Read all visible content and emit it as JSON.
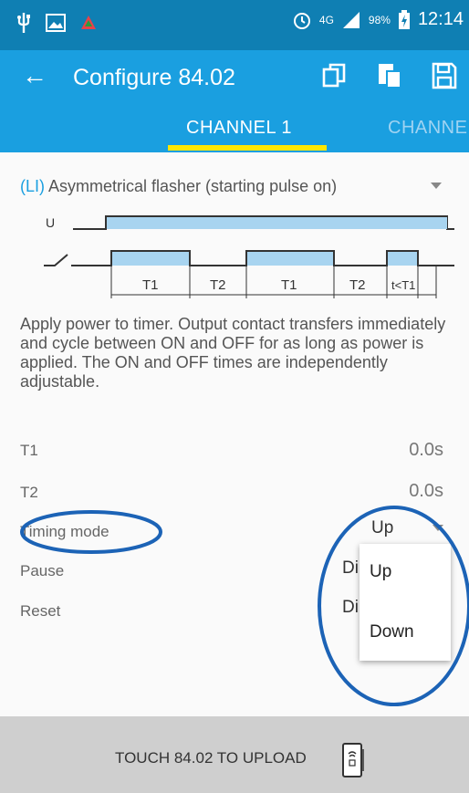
{
  "status_bar": {
    "network": "4G",
    "battery": "98%",
    "time": "12:14"
  },
  "app_bar": {
    "title": "Configure 84.02"
  },
  "tabs": [
    {
      "label": "CHANNEL 1"
    },
    {
      "label": "CHANNE"
    }
  ],
  "mode": {
    "code": "(LI)",
    "name": "Asymmetrical flasher (starting pulse on)"
  },
  "diagram": {
    "u_label": "U",
    "intervals": [
      "T1",
      "T2",
      "T1",
      "T2",
      "t<T1"
    ]
  },
  "description": "Apply power to timer. Output contact transfers immediately and cycle between ON and OFF for as long as power is applied. The ON and OFF times are independently adjustable.",
  "params": {
    "t1": {
      "label": "T1",
      "value": "0.0s"
    },
    "t2": {
      "label": "T2",
      "value": "0.0s"
    },
    "timing_mode": {
      "label": "Timing mode",
      "value": "Up"
    },
    "pause": {
      "label": "Pause",
      "value_partial": "Di"
    },
    "reset": {
      "label": "Reset",
      "value_partial": "Di"
    }
  },
  "dropdown": {
    "options": [
      "Up",
      "Down"
    ]
  },
  "bottom_bar": {
    "label": "TOUCH 84.02 TO UPLOAD"
  },
  "colors": {
    "status_bar": "#0f7fb3",
    "app_bar": "#1a9fe0",
    "tab_indicator": "#ffe600",
    "annotation": "#1c63b6"
  }
}
